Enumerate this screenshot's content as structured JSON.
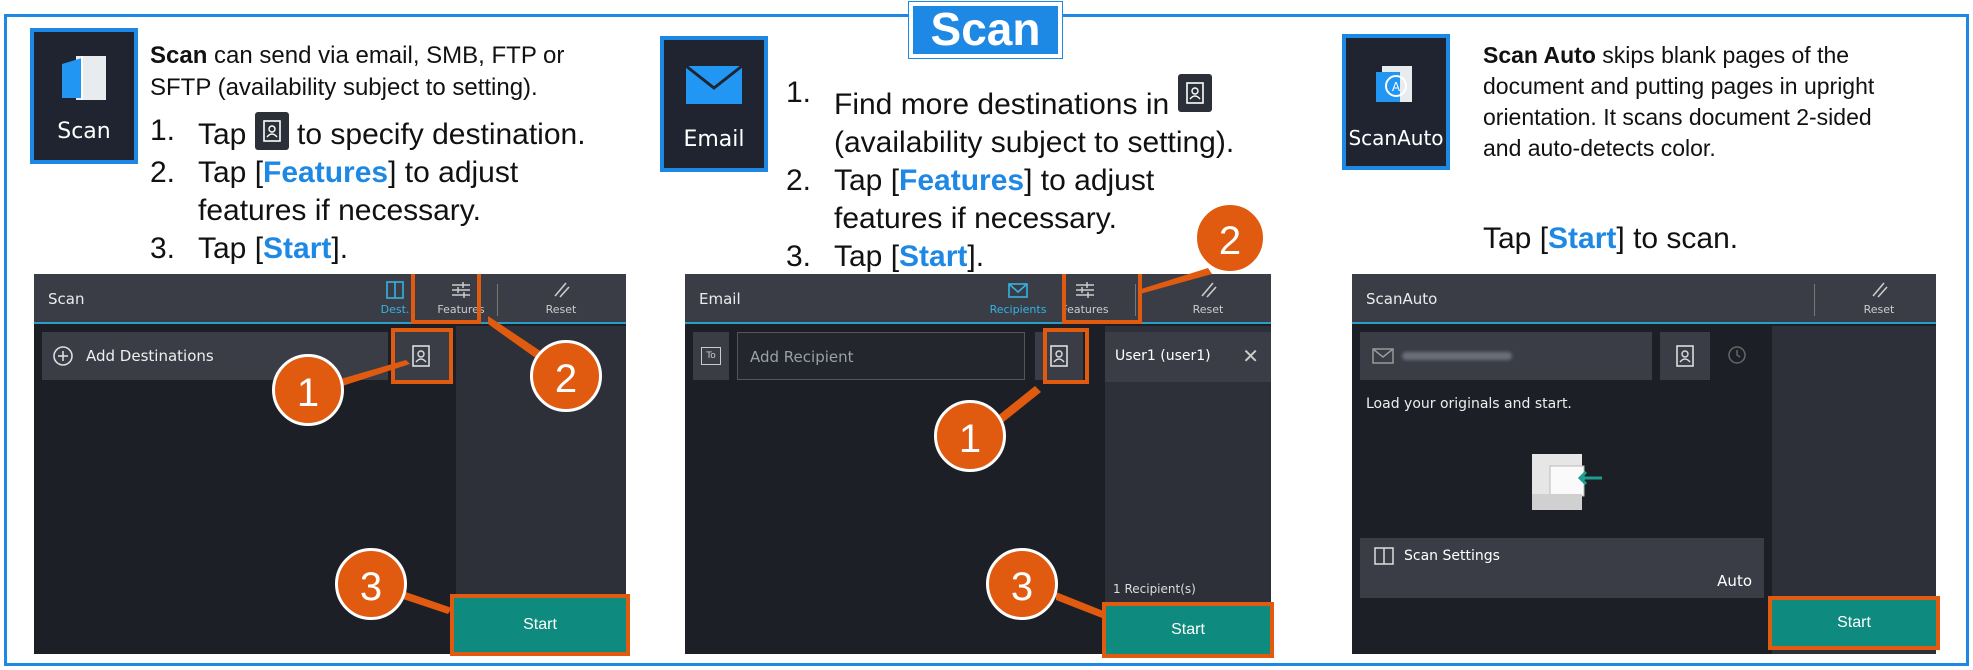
{
  "title": "Scan",
  "colors": {
    "accent": "#1e88e5",
    "highlight": "#e05a10",
    "start_button": "#0e8a7e",
    "screen_bg": "#1c1f26"
  },
  "col1": {
    "tile_label": "Scan",
    "desc_bold": "Scan",
    "desc_rest_1": " can send via email, SMB, FTP or",
    "desc_rest_2": "SFTP (availability subject to setting).",
    "step1_num": "1.",
    "step1_pre": "Tap ",
    "step1_post": " to specify destination.",
    "step2_num": "2.",
    "step2_pre": "Tap [",
    "step2_hl": "Features",
    "step2_post": "] to adjust",
    "step2_line2": "features if necessary.",
    "step3_num": "3.",
    "step3_pre": "Tap [",
    "step3_hl": "Start",
    "step3_post": "].",
    "screen": {
      "title": "Scan",
      "dest_label": "Dest.",
      "features_label": "Features",
      "reset_label": "Reset",
      "add_destinations": "Add Destinations",
      "start": "Start"
    },
    "bubbles": [
      "1",
      "2",
      "3"
    ]
  },
  "col2": {
    "tile_label": "Email",
    "step1_num": "1.",
    "step1_pre": "Find more destinations in ",
    "step1_line2": "(availability subject to setting).",
    "step2_num": "2.",
    "step2_pre": "Tap [",
    "step2_hl": "Features",
    "step2_post": "] to adjust",
    "step2_line2": "features if necessary.",
    "step3_num": "3.",
    "step3_pre": "Tap [",
    "step3_hl": "Start",
    "step3_post": "].",
    "screen": {
      "title": "Email",
      "recipients_label": "Recipients",
      "features_label": "Features",
      "reset_label": "Reset",
      "to_label": "To",
      "add_recipient": "Add Recipient",
      "user": "User1 (user1)",
      "recipient_count": "1 Recipient(s)",
      "start": "Start"
    },
    "bubbles": [
      "1",
      "2",
      "3"
    ]
  },
  "col3": {
    "tile_label": "ScanAuto",
    "desc_bold": "Scan Auto",
    "desc_rest_1": " skips blank pages of the",
    "desc_line2": "document and putting pages in upright",
    "desc_line3": "orientation. It scans document 2-sided",
    "desc_line4": "and auto-detects color.",
    "tap_pre": "Tap [",
    "tap_hl": "Start",
    "tap_post": "] to scan.",
    "screen": {
      "title": "ScanAuto",
      "reset_label": "Reset",
      "load_text": "Load your originals and start.",
      "scan_settings": "Scan Settings",
      "auto": "Auto",
      "start": "Start"
    }
  }
}
